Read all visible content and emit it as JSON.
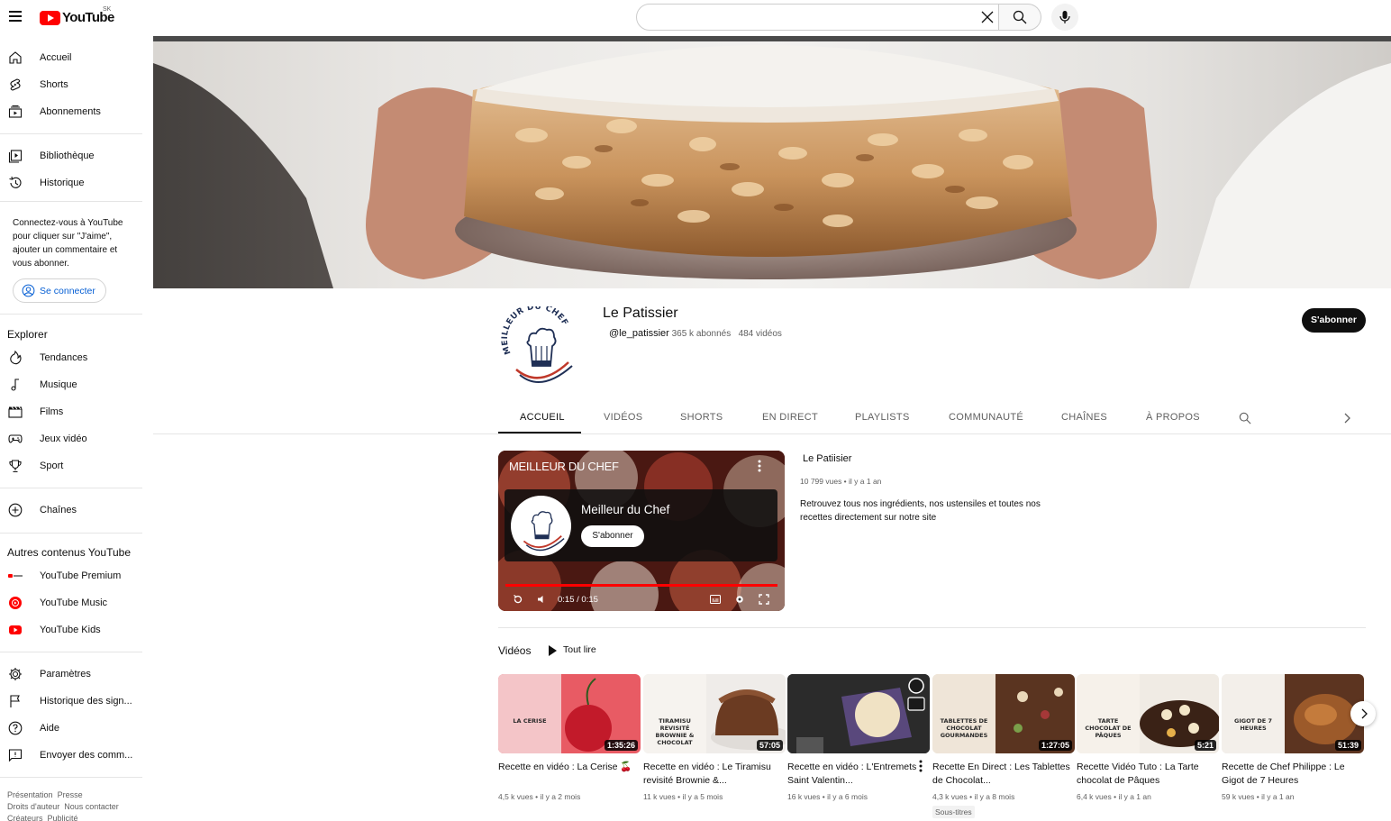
{
  "header": {
    "logo_text": "YouTube",
    "country_code": "SK",
    "search_placeholder": ""
  },
  "sidebar": {
    "main": [
      {
        "label": "Accueil",
        "icon": "home-icon"
      },
      {
        "label": "Shorts",
        "icon": "shorts-icon"
      },
      {
        "label": "Abonnements",
        "icon": "subscriptions-icon"
      }
    ],
    "library": [
      {
        "label": "Bibliothèque",
        "icon": "library-icon"
      },
      {
        "label": "Historique",
        "icon": "history-icon"
      }
    ],
    "signin_text": "Connectez-vous à YouTube pour cliquer sur \"J'aime\", ajouter un commentaire et vous abonner.",
    "signin_button": "Se connecter",
    "explore_title": "Explorer",
    "explore": [
      {
        "label": "Tendances",
        "icon": "trending-icon"
      },
      {
        "label": "Musique",
        "icon": "music-icon"
      },
      {
        "label": "Films",
        "icon": "films-icon"
      },
      {
        "label": "Jeux vidéo",
        "icon": "gaming-icon"
      },
      {
        "label": "Sport",
        "icon": "sport-icon"
      }
    ],
    "channels_label": "Chaînes",
    "other_title": "Autres contenus YouTube",
    "other": [
      {
        "label": "YouTube Premium",
        "icon": "youtube-premium-icon"
      },
      {
        "label": "YouTube Music",
        "icon": "youtube-music-icon"
      },
      {
        "label": "YouTube Kids",
        "icon": "youtube-kids-icon"
      }
    ],
    "settings": [
      {
        "label": "Paramètres",
        "icon": "settings-icon"
      },
      {
        "label": "Historique des sign...",
        "icon": "flag-icon"
      },
      {
        "label": "Aide",
        "icon": "help-icon"
      },
      {
        "label": "Envoyer des comm...",
        "icon": "feedback-icon"
      }
    ],
    "footer": [
      "Présentation",
      "Presse",
      "Droits d'auteur",
      "Nous contacter",
      "Créateurs",
      "Publicité"
    ]
  },
  "channel": {
    "name": "Le Patissier",
    "handle": "@le_patissier",
    "subscribers": "365 k abonnés",
    "videos_count": "484 vidéos",
    "subscribe_label": "S'abonner",
    "avatar_text": "MEILLEUR DU CHEF"
  },
  "tabs": [
    "ACCUEIL",
    "VIDÉOS",
    "SHORTS",
    "EN DIRECT",
    "PLAYLISTS",
    "COMMUNAUTÉ",
    "CHAÎNES",
    "À PROPOS"
  ],
  "featured": {
    "overlay_title": "MEILLEUR DU CHEF",
    "card_name": "Meilleur du Chef",
    "card_button": "S'abonner",
    "time": "0:15 / 0:15",
    "progress": 1.0,
    "info_title": "Le Patiisier",
    "info_meta": "10 799 vues • il y a 1 an",
    "info_desc": "Retrouvez tous nos ingrédients, nos ustensiles et toutes nos recettes directement sur notre site"
  },
  "videos_section": {
    "title": "Vidéos",
    "play_all": "Tout lire",
    "items": [
      {
        "title": "Recette en vidéo : La Cerise 🍒",
        "meta": "4,5 k vues • il y a 2 mois",
        "duration": "1:35:26",
        "thumb_label": "LA CERISE",
        "bg": "#e85b64"
      },
      {
        "title": "Recette en vidéo : Le Tiramisu revisité Brownie &...",
        "meta": "11 k vues • il y a 5 mois",
        "duration": "57:05",
        "thumb_label": "TIRAMISU REVISITÉ BROWNIE & CHOCOLAT",
        "bg": "#efece9"
      },
      {
        "title": "Recette en vidéo : L'Entremets Saint Valentin...",
        "meta": "16 k vues • il y a 6 mois",
        "duration": "",
        "thumb_label": "",
        "bg": "#2b2b2b"
      },
      {
        "title": "Recette En Direct : Les Tablettes de Chocolat...",
        "meta": "4,3 k vues • il y a 8 mois",
        "duration": "1:27:05",
        "thumb_label": "TABLETTES DE CHOCOLAT GOURMANDES",
        "bg": "#e8ddd0",
        "badge": "Sous-titres"
      },
      {
        "title": "Recette Vidéo Tuto : La Tarte chocolat de Pâques",
        "meta": "6,4 k vues • il y a 1 an",
        "duration": "5:21",
        "thumb_label": "TARTE CHOCOLAT DE PÂQUES",
        "bg": "#f0ebe4"
      },
      {
        "title": "Recette de Chef Philippe : Le Gigot de 7 Heures",
        "meta": "59 k vues • il y a 1 an",
        "duration": "51:39",
        "thumb_label": "GIGOT DE 7 HEURES",
        "bg": "#e9e6e2"
      }
    ]
  }
}
